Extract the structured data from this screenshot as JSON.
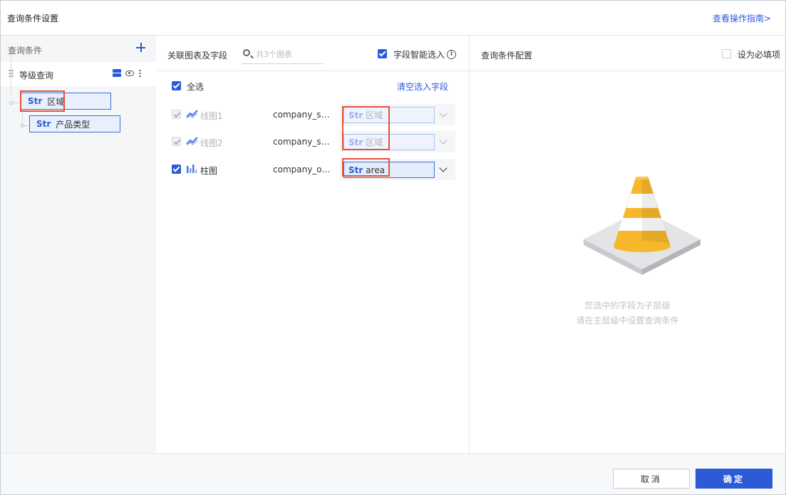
{
  "dialog": {
    "title": "查询条件设置",
    "guide_link": "查看操作指南>"
  },
  "left_panel": {
    "title": "查询条件",
    "group": {
      "label": "等级查询",
      "icons": [
        "drag-handle-icon",
        "database-icon",
        "eye-icon",
        "more-icon"
      ]
    },
    "fields": [
      {
        "type": "Str",
        "name": "区域",
        "highlighted": true
      },
      {
        "type": "Str",
        "name": "产品类型",
        "highlighted": false
      }
    ]
  },
  "middle_panel": {
    "title": "关联图表及字段",
    "search_placeholder": "共3个图表",
    "smart_select_label": "字段智能选入",
    "select_all_label": "全选",
    "clear_link": "清空选入字段",
    "rows": [
      {
        "chart": "线图1",
        "chart_icon": "line-chart-icon",
        "dataset": "company_sal...",
        "field_type": "Str",
        "field": "区域",
        "checked": true,
        "disabled": true
      },
      {
        "chart": "线图2",
        "chart_icon": "line-chart-icon",
        "dataset": "company_sal...",
        "field_type": "Str",
        "field": "区域",
        "checked": true,
        "disabled": true
      },
      {
        "chart": "柱图",
        "chart_icon": "bar-chart-icon",
        "dataset": "company_ord...",
        "field_type": "Str",
        "field": "area",
        "checked": true,
        "disabled": false
      }
    ]
  },
  "right_panel": {
    "title": "查询条件配置",
    "required_label": "设为必填项",
    "empty_line1": "您选中的字段为子层级",
    "empty_line2": "请在主层级中设置查询条件"
  },
  "footer": {
    "cancel_label": "取消",
    "ok_label": "确定"
  },
  "colors": {
    "accent": "#2d5bd8",
    "highlight_box": "#e8503a",
    "cone_orange": "#f6b72a",
    "cone_white": "#ffffff"
  }
}
